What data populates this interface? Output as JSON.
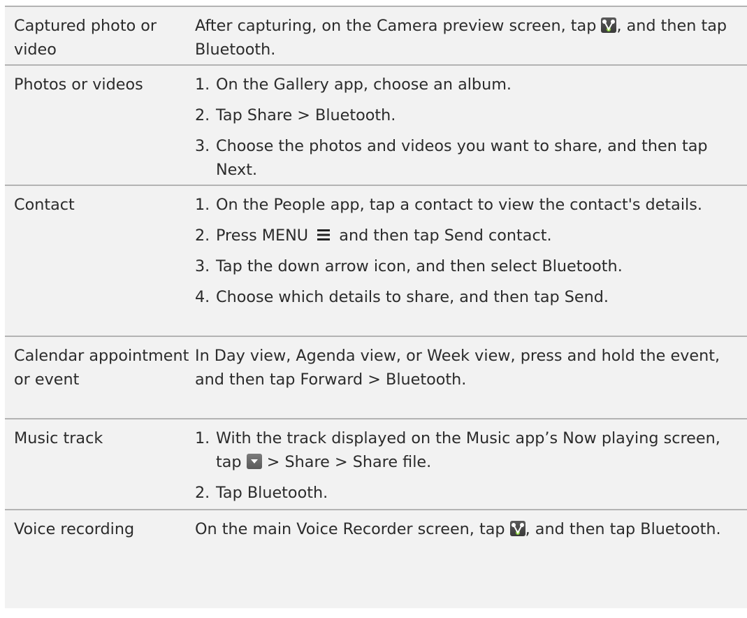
{
  "rows": [
    {
      "label": "Captured photo or video",
      "p1": "After capturing, on the Camera preview screen, tap ",
      "p2": ", and then tap ",
      "p3": "Bluetooth",
      "p4": "."
    },
    {
      "label": "Photos or videos",
      "steps": [
        {
          "num": "1.",
          "a": "On the Gallery app, choose an album."
        },
        {
          "num": "2.",
          "a": "Tap ",
          "b": "Share",
          "c": " > ",
          "d": "Bluetooth",
          "e": "."
        },
        {
          "num": "3.",
          "a": "Choose the photos and videos you want to share, and then tap ",
          "b": "Next",
          "c": "."
        }
      ]
    },
    {
      "label": "Contact",
      "steps": [
        {
          "num": "1.",
          "a": "On the People app, tap a contact to view the contact's details."
        },
        {
          "num": "2.",
          "a": "Press MENU ",
          "b": " and then tap ",
          "c": "Send contact",
          "d": "."
        },
        {
          "num": "3.",
          "a": "Tap the down arrow icon, and then select ",
          "b": "Bluetooth",
          "c": "."
        },
        {
          "num": "4.",
          "a": "Choose which details to share, and then tap ",
          "b": "Send",
          "c": "."
        }
      ]
    },
    {
      "label": "Calendar appointment or event",
      "p1": "In Day view, Agenda view, or Week view, press and hold the event, and then tap ",
      "p2": "Forward",
      "p3": " > ",
      "p4": "Bluetooth",
      "p5": "."
    },
    {
      "label": "Music track",
      "steps": [
        {
          "num": "1.",
          "a": "With the track displayed on the Music app’s Now playing screen, tap ",
          "b": " > ",
          "c": "Share",
          "d": " > ",
          "e": "Share file",
          "f": "."
        },
        {
          "num": "2.",
          "a": "Tap ",
          "b": "Bluetooth",
          "c": "."
        }
      ]
    },
    {
      "label": "Voice recording",
      "p1": "On the main Voice Recorder screen, tap ",
      "p2": ", and then tap ",
      "p3": "Bluetooth",
      "p4": "."
    }
  ],
  "icons": {
    "share": "share-icon",
    "menu": "menu-icon",
    "dropdown": "dropdown-arrow-icon"
  }
}
